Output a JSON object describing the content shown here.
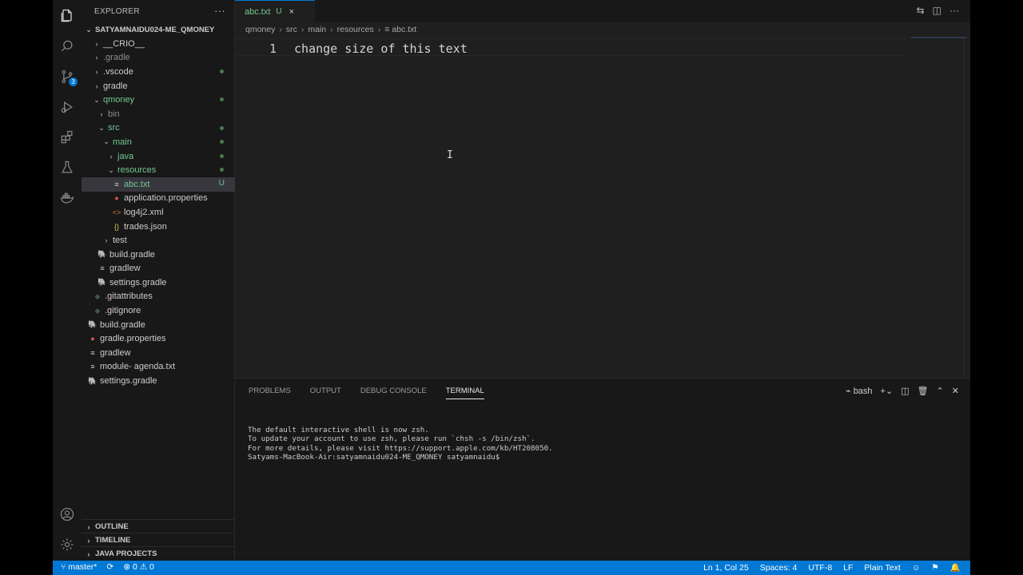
{
  "sidebar": {
    "title": "EXPLORER",
    "more": "···",
    "project": "SATYAMNAIDU024-ME_QMONEY",
    "tree": [
      {
        "label": "__CRIO__",
        "depth": 0,
        "type": "folder",
        "color": "norm",
        "chev": "›"
      },
      {
        "label": ".gradle",
        "depth": 0,
        "type": "folder",
        "color": "ign",
        "chev": "›"
      },
      {
        "label": ".vscode",
        "depth": 0,
        "type": "folder",
        "color": "norm",
        "chev": "›",
        "dot": true
      },
      {
        "label": "gradle",
        "depth": 0,
        "type": "folder",
        "color": "norm",
        "chev": "›"
      },
      {
        "label": "qmoney",
        "depth": 0,
        "type": "folder",
        "color": "git",
        "chev": "⌄",
        "dot": true
      },
      {
        "label": "bin",
        "depth": 1,
        "type": "folder",
        "color": "ign",
        "chev": "›"
      },
      {
        "label": "src",
        "depth": 1,
        "type": "folder",
        "color": "git",
        "chev": "⌄",
        "dot": true
      },
      {
        "label": "main",
        "depth": 2,
        "type": "folder",
        "color": "git",
        "chev": "⌄",
        "dot": true
      },
      {
        "label": "java",
        "depth": 3,
        "type": "folder",
        "color": "git",
        "chev": "›",
        "dot": true
      },
      {
        "label": "resources",
        "depth": 3,
        "type": "folder",
        "color": "git",
        "chev": "⌄",
        "dot": true
      },
      {
        "label": "abc.txt",
        "depth": 4,
        "type": "file",
        "icon": "≡",
        "iconColor": "#cccccc",
        "color": "git",
        "selected": true,
        "u": "U"
      },
      {
        "label": "application.properties",
        "depth": 4,
        "type": "file",
        "icon": "●",
        "iconColor": "#e05252",
        "color": "norm"
      },
      {
        "label": "log4j2.xml",
        "depth": 4,
        "type": "file",
        "icon": "<>",
        "iconColor": "#e37933",
        "color": "norm"
      },
      {
        "label": "trades.json",
        "depth": 4,
        "type": "file",
        "icon": "{}",
        "iconColor": "#cbcb41",
        "color": "norm"
      },
      {
        "label": "test",
        "depth": 2,
        "type": "folder",
        "color": "norm",
        "chev": "›"
      },
      {
        "label": "build.gradle",
        "depth": 1,
        "type": "file",
        "icon": "🐘",
        "iconColor": "#519aba",
        "color": "norm"
      },
      {
        "label": "gradlew",
        "depth": 1,
        "type": "file",
        "icon": "≡",
        "iconColor": "#cccccc",
        "color": "norm"
      },
      {
        "label": "settings.gradle",
        "depth": 1,
        "type": "file",
        "icon": "🐘",
        "iconColor": "#519aba",
        "color": "norm"
      },
      {
        "label": ".gitattributes",
        "depth": 0,
        "type": "file",
        "icon": "◆",
        "iconColor": "#41535b",
        "color": "norm"
      },
      {
        "label": ".gitignore",
        "depth": 0,
        "type": "file",
        "icon": "◆",
        "iconColor": "#41535b",
        "color": "norm"
      },
      {
        "label": "build.gradle",
        "depth": 0,
        "type": "file",
        "icon": "🐘",
        "iconColor": "#519aba",
        "color": "norm",
        "noindent": true
      },
      {
        "label": "gradle.properties",
        "depth": 0,
        "type": "file",
        "icon": "●",
        "iconColor": "#e05252",
        "color": "norm",
        "noindent": true
      },
      {
        "label": "gradlew",
        "depth": 0,
        "type": "file",
        "icon": "≡",
        "iconColor": "#cccccc",
        "color": "norm",
        "noindent": true
      },
      {
        "label": "module- agenda.txt",
        "depth": 0,
        "type": "file",
        "icon": "≡",
        "iconColor": "#cccccc",
        "color": "norm",
        "noindent": true
      },
      {
        "label": "settings.gradle",
        "depth": 0,
        "type": "file",
        "icon": "🐘",
        "iconColor": "#519aba",
        "color": "norm",
        "noindent": true
      }
    ],
    "sections": {
      "outline": "OUTLINE",
      "timeline": "TIMELINE",
      "java_projects": "JAVA PROJECTS"
    }
  },
  "activity": {
    "scm_badge": "3"
  },
  "tab": {
    "name": "abc.txt",
    "status": "U",
    "close": "×"
  },
  "breadcrumb": [
    "qmoney",
    "src",
    "main",
    "resources",
    "abc.txt"
  ],
  "editor": {
    "line_number": "1",
    "line_text": "change size of this text"
  },
  "panel": {
    "tabs": [
      "PROBLEMS",
      "OUTPUT",
      "DEBUG CONSOLE",
      "TERMINAL"
    ],
    "active_tab": "TERMINAL",
    "shell": "bash",
    "terminal_lines": [
      "",
      "The default interactive shell is now zsh.",
      "To update your account to use zsh, please run `chsh -s /bin/zsh`.",
      "For more details, please visit https://support.apple.com/kb/HT208050.",
      "Satyams-MacBook-Air:satyamnaidu024-ME_QMONEY satyamnaidu$"
    ]
  },
  "status": {
    "branch": "master*",
    "errors": "0",
    "warnings": "0",
    "position": "Ln 1, Col 25",
    "spaces": "Spaces: 4",
    "encoding": "UTF-8",
    "eol": "LF",
    "language": "Plain Text"
  }
}
